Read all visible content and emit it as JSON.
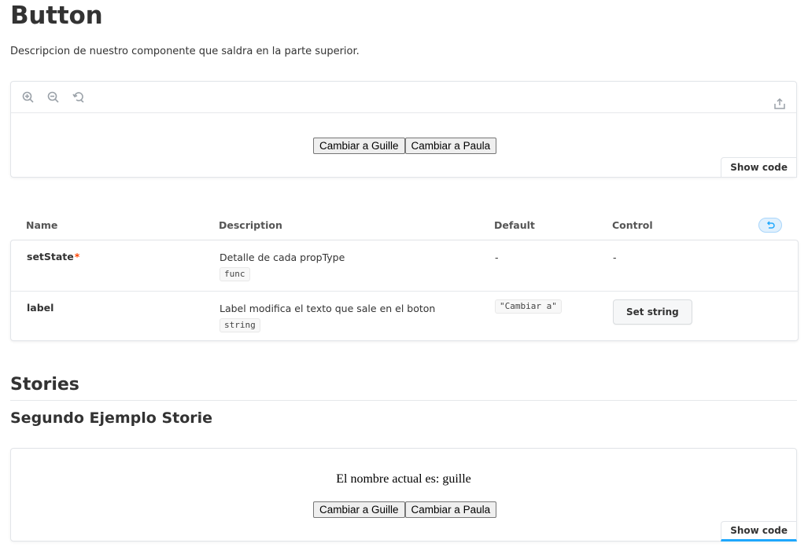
{
  "page": {
    "title": "Button",
    "description": "Descripcion de nuestro componente que saldra en la parte superior."
  },
  "preview": {
    "toolbar": {
      "icons": [
        "zoom-in-icon",
        "zoom-out-icon",
        "zoom-reset-icon",
        "share-icon"
      ]
    },
    "buttons": [
      "Cambiar a Guille",
      "Cambiar a Paula"
    ],
    "show_code_label": "Show code"
  },
  "args_table": {
    "headers": {
      "name": "Name",
      "description": "Description",
      "default": "Default",
      "control": "Control"
    },
    "reset_icon": "undo-icon",
    "rows": [
      {
        "name": "setState",
        "required_mark": "*",
        "description": "Detalle de cada propType",
        "type": "func",
        "default": "-",
        "control": "-"
      },
      {
        "name": "label",
        "description": "Label modifica el texto que sale en el boton",
        "type": "string",
        "default": "\"Cambiar a\"",
        "control_button": "Set string"
      }
    ]
  },
  "stories": {
    "heading": "Stories",
    "story_title": "Segundo Ejemplo Storie",
    "story_text": "El nombre actual es: guille",
    "buttons": [
      "Cambiar a Guille",
      "Cambiar a Paula"
    ],
    "show_code_label": "Show code"
  },
  "colors": {
    "accent": "#1ea7fd",
    "required": "#ff4400",
    "border": "#e2e5e9"
  }
}
